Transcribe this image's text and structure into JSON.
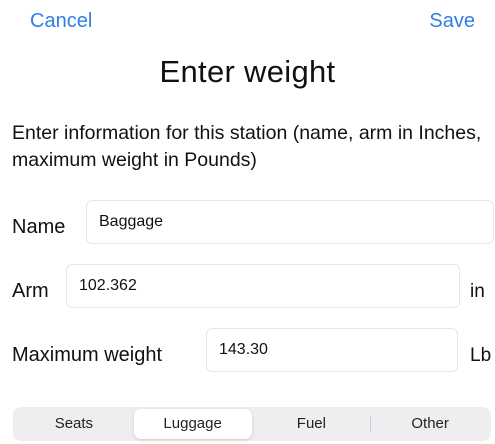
{
  "nav": {
    "cancel_label": "Cancel",
    "save_label": "Save",
    "accent_color": "#2f7fe6"
  },
  "title": "Enter weight",
  "description": "Enter information for this station (name, arm in Inches, maximum weight in Pounds)",
  "form": {
    "name": {
      "label": "Name",
      "value": "Baggage"
    },
    "arm": {
      "label": "Arm",
      "value": "102.362",
      "unit": "in"
    },
    "maximum_weight": {
      "label": "Maximum weight",
      "value": "143.30",
      "unit": "Lb"
    }
  },
  "segments": {
    "items": [
      "Seats",
      "Luggage",
      "Fuel",
      "Other"
    ],
    "selected": "Luggage"
  }
}
